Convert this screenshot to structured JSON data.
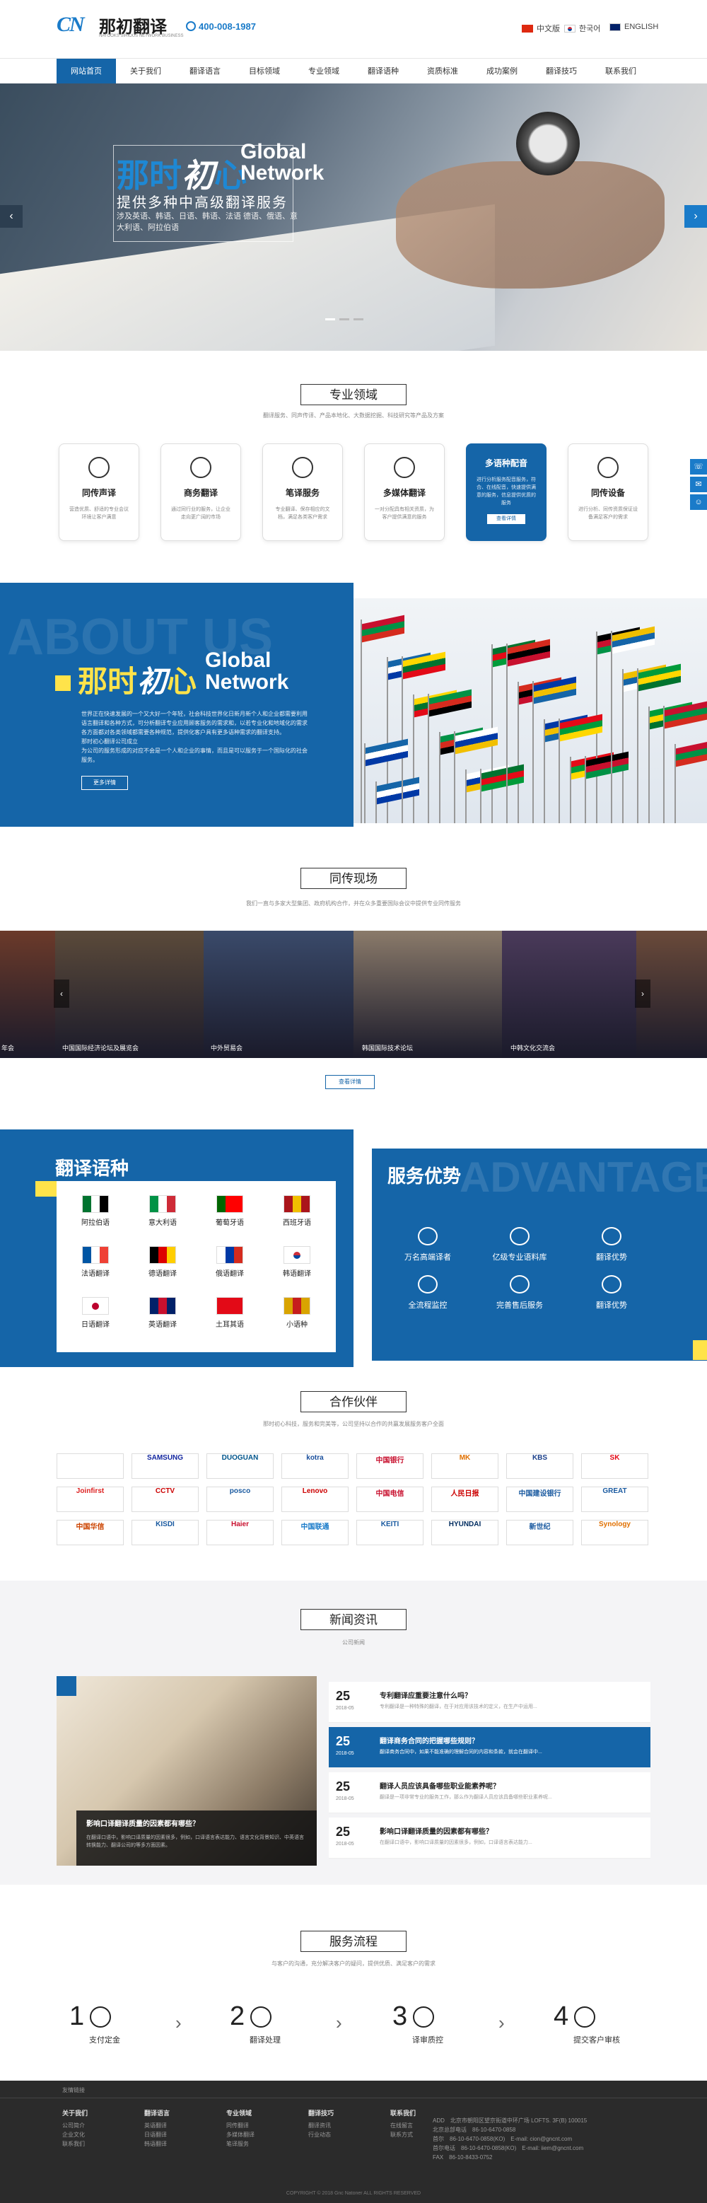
{
  "header": {
    "logo_mark": "CN",
    "logo_name": "那初翻译",
    "logo_sub": "NATOOKS SIRIOUS NETWORK BUSINESS",
    "phone": "400-008-1987",
    "langs": [
      {
        "label": "中文版"
      },
      {
        "label": "한국어"
      },
      {
        "label": "ENGLISH"
      }
    ]
  },
  "nav": [
    "网站首页",
    "关于我们",
    "翻译语言",
    "目标领域",
    "专业领域",
    "翻译语种",
    "资质标准",
    "成功案例",
    "翻译技巧",
    "联系我们"
  ],
  "hero": {
    "t1a": "那时",
    "t1b": "初",
    "t1c": "心",
    "t1en1": "Global",
    "t1en2": "Network",
    "t2": "提供多种中高级翻译服务",
    "t3": "涉及英语、韩语、日语、韩语、法语 德语、俄语、意大利语、阿拉伯语"
  },
  "specialty": {
    "title": "专业领域",
    "sub": "翻译服务、同声传译、产品本地化、大数据挖掘、科技研究等产品及方案",
    "cards": [
      {
        "name": "同传声译",
        "desc": "营造优质、舒适的专业会议环境让客户满意"
      },
      {
        "name": "商务翻译",
        "desc": "通过同行业的服务，让企业走向更广阔的市场"
      },
      {
        "name": "笔译服务",
        "desc": "专业翻译、保存相应的文档，满足各类客户需求"
      },
      {
        "name": "多媒体翻译",
        "desc": "一对分配具有相关资质，为客户提供满意的服务"
      },
      {
        "name": "多语种配音",
        "desc": "进行分析服务配音服务，符合、在线配音，快速提供满意的服务，信息提供优质的服务",
        "more": "查看详情"
      },
      {
        "name": "同传设备",
        "desc": "进行分析、同传资质保证设备满足客户的需求"
      }
    ]
  },
  "side": [
    "☏",
    "✉",
    "☺"
  ],
  "about": {
    "bg": "ABOUT US",
    "t_a": "那时",
    "t_b": "初",
    "t_c": "心",
    "en1": "Global",
    "en2": "Network",
    "para": "世界正在快速发展的一个又大好一个年轻，社会科技世界化日新月新个人和企业都需要利用语言翻译和各种方式，可分析翻译专业应用顾客服务的需求和，以若专业化和地域化的需求各方面都对各类领域都需要各种规范，提供化客户具有更多语种需求的翻译支持。",
    "para2": "那时初心翻译公司成立",
    "para3": "为公司的服务形成的对应不会是一个人和企业的事情，而且是可以服务于一个国际化的社会服务。",
    "btn": "更多详情"
  },
  "live": {
    "title": "同传现场",
    "sub": "我们一直与多家大型集团、政府机构合作，并在众多重要国际会议中提供专业同传服务",
    "captions": [
      "年会",
      "中国国际经济论坛及展览会",
      "中外贸易会",
      "韩国国际技术论坛",
      "中韩文化交流会"
    ],
    "more": "查看详情"
  },
  "languages": {
    "title": "翻译语种",
    "items": [
      "阿拉伯语",
      "意大利语",
      "葡萄牙语",
      "西班牙语",
      "法语翻译",
      "德语翻译",
      "俄语翻译",
      "韩语翻译",
      "日语翻译",
      "英语翻译",
      "土耳其语",
      "小语种"
    ],
    "flag_colors": [
      [
        "#00732f",
        "#fff",
        "#000"
      ],
      [
        "#009246",
        "#fff",
        "#ce2b37"
      ],
      [
        "#006600",
        "#ff0000",
        "#ff0000"
      ],
      [
        "#aa151b",
        "#f1bf00",
        "#aa151b"
      ],
      [
        "#0055a4",
        "#fff",
        "#ef4135"
      ],
      [
        "#000",
        "#dd0000",
        "#ffce00"
      ],
      [
        "#fff",
        "#0039a6",
        "#d52b1e"
      ],
      [
        "#fff",
        "#fff",
        "#fff"
      ],
      [
        "#fff",
        "#fff",
        "#fff"
      ],
      [
        "#012169",
        "#c8102e",
        "#012169"
      ],
      [
        "#e30a17",
        "#e30a17",
        "#e30a17"
      ],
      [
        "#d9a400",
        "#c61d1d",
        "#d9a400"
      ]
    ]
  },
  "advantage": {
    "title": "服务优势",
    "bg": "ADVANTAGE",
    "items": [
      "万名高端译者",
      "亿级专业语料库",
      "翻译优势",
      "全流程监控",
      "完善售后服务",
      "翻译优势"
    ]
  },
  "partners": {
    "title": "合作伙伴",
    "sub": "那时初心科技，服务和完美等，公司坚持以合作的共赢发展服务客户全面",
    "logos": [
      "",
      "SAMSUNG",
      "DUOGUAN",
      "kotra",
      "中国银行",
      "MK",
      "KBS",
      "SK",
      "Joinfirst",
      "CCTV",
      "posco",
      "Lenovo",
      "中国电信",
      "人民日报",
      "中国建设银行",
      "GREAT",
      "中国华信",
      "KISDI",
      "Haier",
      "中国联通",
      "KEITI",
      "HYUNDAI",
      "新世纪",
      "Synology"
    ]
  },
  "news": {
    "title": "新闻资讯",
    "sub": "公司新闻",
    "img_title": "影响口译翻译质量的因素都有哪些？",
    "img_desc": "在翻译口语中，影响口译质量的因素很多，例如，口译语言表达能力、语言文化背景知识、中英语言转换能力、翻译公司的等多方面因素。",
    "items": [
      {
        "d": "25",
        "m": "2018-05",
        "t": "专利翻译应重要注意什么吗？",
        "s": "专利翻译是一种特殊的翻译，在于对应用该技术的定义，在生产中运用..."
      },
      {
        "d": "25",
        "m": "2018-05",
        "t": "翻译商务合同的把握哪些规则？",
        "s": "翻译商务合同中，如果不能准确的理解合同的内容和条款，就会在翻译中..."
      },
      {
        "d": "25",
        "m": "2018-05",
        "t": "翻译人员应该具备哪些职业能素养呢？",
        "s": "翻译是一项非常专业的服务工作，那么作为翻译人员应该具备哪些职业素养呢..."
      },
      {
        "d": "25",
        "m": "2018-05",
        "t": "影响口译翻译质量的因素都有哪些？",
        "s": "在翻译口语中，影响口译质量的因素很多，例如，口译语言表达能力..."
      }
    ]
  },
  "process": {
    "title": "服务流程",
    "sub": "与客户的沟通，充分解决客户的疑问，提供优质、满足客户的需求",
    "steps": [
      {
        "n": "1",
        "l": "支付定金"
      },
      {
        "n": "2",
        "l": "翻译处理"
      },
      {
        "n": "3",
        "l": "译审质控"
      },
      {
        "n": "4",
        "l": "提交客户审核"
      }
    ]
  },
  "footer": {
    "links_title": "友情链接",
    "cols": [
      {
        "h": "关于我们",
        "items": [
          "公司简介",
          "企业文化",
          "联系我们"
        ]
      },
      {
        "h": "翻译语言",
        "items": [
          "英语翻译",
          "日语翻译",
          "韩语翻译"
        ]
      },
      {
        "h": "专业领域",
        "items": [
          "同传翻译",
          "多媒体翻译",
          "笔译服务"
        ]
      },
      {
        "h": "翻译技巧",
        "items": [
          "翻译资讯",
          "行业动态"
        ]
      },
      {
        "h": "联系我们",
        "items": [
          "在线留言",
          "联系方式"
        ]
      }
    ],
    "contact": {
      "add_label": "ADD",
      "add": "北京市朝阳区望京街道中环广场 LOFTS. 3F(B) 100015",
      "tel1_label": "北京总部电话",
      "tel1": "86-10-6470-0858",
      "tel2_label": "首尔",
      "tel2": "86-10-6470-0858(KO)",
      "email_label": "E-mail",
      "email": "cion@gncnt.com",
      "tel3_label": "首尔电话",
      "tel3": "86-10-6470-0858(KO)",
      "fax_label": "FAX",
      "fax": "86-10-8433-0752",
      "email2": "iiem@gncnt.com"
    },
    "copyright": "COPYRIGHT © 2018 Gnc Natoner ALL RIGHTS RESERVED"
  }
}
